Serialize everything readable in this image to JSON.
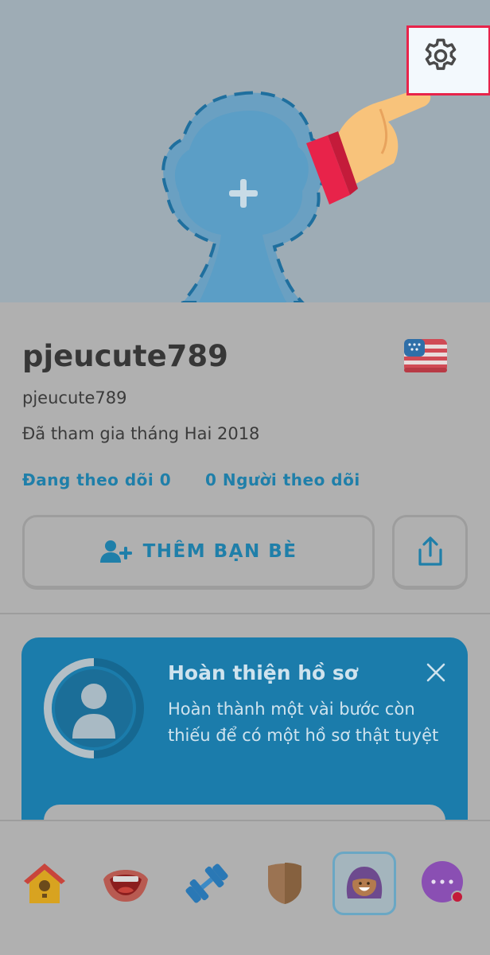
{
  "profile": {
    "display_name": "pjeucute789",
    "username": "pjeucute789",
    "joined": "Đã tham gia tháng Hai 2018",
    "following": "Đang theo dõi 0",
    "followers": "0 Người theo dõi",
    "flag_icon": "us-flag-icon"
  },
  "actions": {
    "add_friends_label": "THÊM BẠN BÈ",
    "share_icon": "share-icon"
  },
  "card": {
    "title": "Hoàn thiện hồ sơ",
    "body": "Hoàn thành một vài bước còn thiếu để có một hồ sơ thật tuyệt"
  },
  "colors": {
    "highlight": "#e8234a",
    "accent": "#1f7fa9",
    "card": "#1b7cab"
  },
  "tabs": [
    {
      "name": "home-tab",
      "icon": "birdhouse-icon"
    },
    {
      "name": "speaking-tab",
      "icon": "mouth-icon"
    },
    {
      "name": "practice-tab",
      "icon": "dumbbell-icon"
    },
    {
      "name": "league-tab",
      "icon": "shield-icon"
    },
    {
      "name": "profile-tab",
      "icon": "avatar-icon",
      "active": true
    },
    {
      "name": "more-tab",
      "icon": "more-icon"
    }
  ]
}
